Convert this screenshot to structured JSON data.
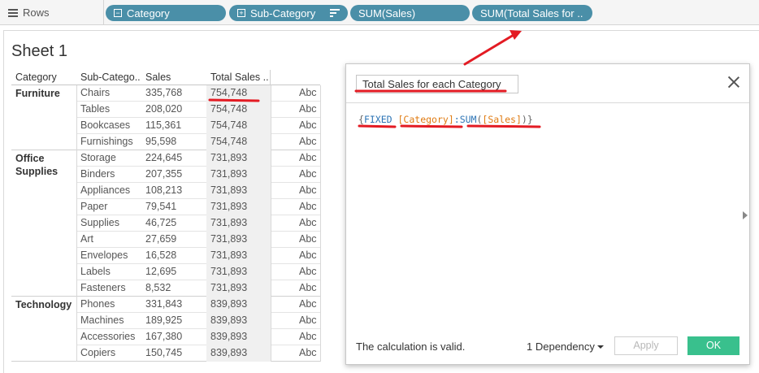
{
  "shelf": {
    "label": "Rows",
    "pills": [
      {
        "label": "Category"
      },
      {
        "label": "Sub-Category"
      },
      {
        "label": "SUM(Sales)"
      },
      {
        "label": "SUM(Total Sales for .."
      }
    ]
  },
  "sheet": {
    "title": "Sheet 1",
    "headers": [
      "Category",
      "Sub-Catego..",
      "Sales",
      "Total Sales .."
    ],
    "groups": [
      {
        "name": "Furniture",
        "rows": [
          {
            "sub": "Chairs",
            "sales": "335,768",
            "total": "754,748",
            "abc": "Abc"
          },
          {
            "sub": "Tables",
            "sales": "208,020",
            "total": "754,748",
            "abc": "Abc"
          },
          {
            "sub": "Bookcases",
            "sales": "115,361",
            "total": "754,748",
            "abc": "Abc"
          },
          {
            "sub": "Furnishings",
            "sales": "95,598",
            "total": "754,748",
            "abc": "Abc"
          }
        ]
      },
      {
        "name": "Office Supplies",
        "rows": [
          {
            "sub": "Storage",
            "sales": "224,645",
            "total": "731,893",
            "abc": "Abc"
          },
          {
            "sub": "Binders",
            "sales": "207,355",
            "total": "731,893",
            "abc": "Abc"
          },
          {
            "sub": "Appliances",
            "sales": "108,213",
            "total": "731,893",
            "abc": "Abc"
          },
          {
            "sub": "Paper",
            "sales": "79,541",
            "total": "731,893",
            "abc": "Abc"
          },
          {
            "sub": "Supplies",
            "sales": "46,725",
            "total": "731,893",
            "abc": "Abc"
          },
          {
            "sub": "Art",
            "sales": "27,659",
            "total": "731,893",
            "abc": "Abc"
          },
          {
            "sub": "Envelopes",
            "sales": "16,528",
            "total": "731,893",
            "abc": "Abc"
          },
          {
            "sub": "Labels",
            "sales": "12,695",
            "total": "731,893",
            "abc": "Abc"
          },
          {
            "sub": "Fasteners",
            "sales": "8,532",
            "total": "731,893",
            "abc": "Abc"
          }
        ]
      },
      {
        "name": "Technology",
        "rows": [
          {
            "sub": "Phones",
            "sales": "331,843",
            "total": "839,893",
            "abc": "Abc"
          },
          {
            "sub": "Machines",
            "sales": "189,925",
            "total": "839,893",
            "abc": "Abc"
          },
          {
            "sub": "Accessories",
            "sales": "167,380",
            "total": "839,893",
            "abc": "Abc"
          },
          {
            "sub": "Copiers",
            "sales": "150,745",
            "total": "839,893",
            "abc": "Abc"
          }
        ]
      }
    ]
  },
  "dialog": {
    "title": "Total Sales for each Category",
    "formula": {
      "open": "{",
      "keyword": "FIXED",
      "field1": "[Category]",
      "colon": ":",
      "func": "SUM",
      "paren_open": "(",
      "field2": "[Sales]",
      "paren_close": ")",
      "close": "}"
    },
    "status": "The calculation is valid.",
    "dependency": "1 Dependency",
    "apply": "Apply",
    "ok": "OK"
  },
  "colors": {
    "pill": "#4a8fa8",
    "ok_button": "#39c08d",
    "annotation": "#e31b23",
    "formula_keyword": "#2e75b6",
    "formula_field": "#e07b12"
  }
}
